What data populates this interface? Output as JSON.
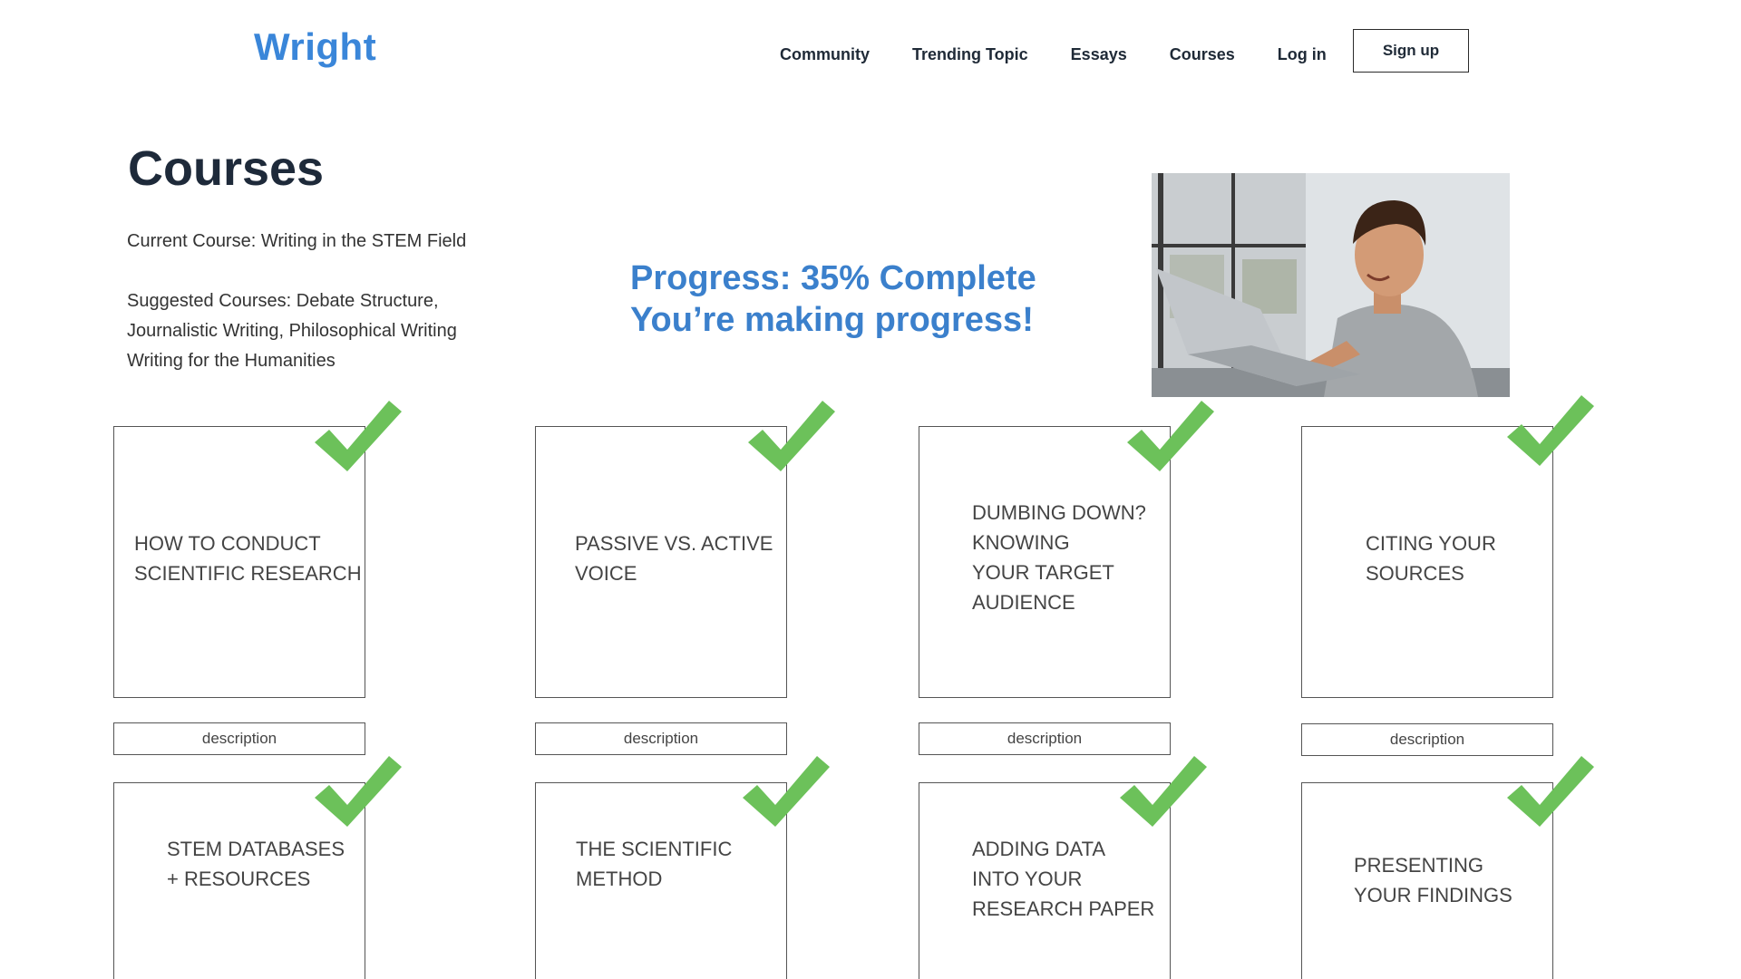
{
  "header": {
    "logo": "Wright",
    "nav": [
      "Community",
      "Trending Topic",
      "Essays",
      "Courses",
      "Log in"
    ],
    "signup_label": "Sign up"
  },
  "main": {
    "title": "Courses",
    "current_course": "Current Course: Writing in the STEM Field",
    "suggested_lines": [
      "Suggested Courses: Debate Structure,",
      "Journalistic Writing, Philosophical Writing",
      "Writing for the Humanities"
    ],
    "progress_line1": "Progress: 35% Complete",
    "progress_line2": "You’re making progress!",
    "progress_percent": 35
  },
  "cards": [
    {
      "lines": [
        "HOW TO CONDUCT",
        "SCIENTIFIC RESEARCH"
      ],
      "description": "description",
      "completed": true
    },
    {
      "lines": [
        "PASSIVE VS. ACTIVE",
        "VOICE"
      ],
      "description": "description",
      "completed": true
    },
    {
      "lines": [
        "DUMBING DOWN?",
        "KNOWING",
        "YOUR TARGET",
        "AUDIENCE"
      ],
      "description": "description",
      "completed": true
    },
    {
      "lines": [
        "CITING YOUR",
        "SOURCES"
      ],
      "description": "description",
      "completed": true
    },
    {
      "lines": [
        "STEM DATABASES",
        "+ RESOURCES"
      ],
      "completed": true
    },
    {
      "lines": [
        "THE SCIENTIFIC",
        "METHOD"
      ],
      "completed": true
    },
    {
      "lines": [
        "ADDING DATA",
        "INTO YOUR",
        "RESEARCH PAPER"
      ],
      "completed": true
    },
    {
      "lines": [
        "PRESENTING",
        "YOUR FINDINGS"
      ],
      "completed": true
    }
  ],
  "colors": {
    "brand": "#3a86d9",
    "progress": "#3b80cc",
    "check": "#6cc15a"
  },
  "icons": {
    "check": "checkmark-icon"
  }
}
